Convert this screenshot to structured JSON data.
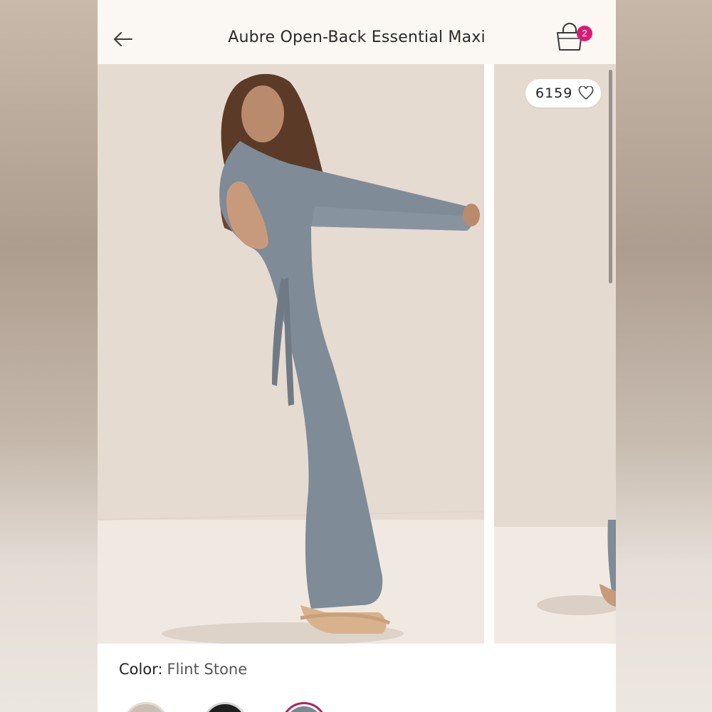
{
  "header": {
    "title": "Aubre Open-Back Essential Maxi",
    "bag_count": "2"
  },
  "gallery": {
    "like_count": "6159"
  },
  "product": {
    "color_label": "Color:",
    "color_value": "Flint Stone"
  },
  "swatches": [
    {
      "name": "beige",
      "color": "#cbbfb3"
    },
    {
      "name": "black",
      "color": "#1f1f1f"
    },
    {
      "name": "flint-stone",
      "color": "#7d8791",
      "selected": true
    }
  ],
  "colors": {
    "accent_badge": "#d81b78",
    "dress": "#7f8b97",
    "header_bg": "#fbf7f2"
  }
}
